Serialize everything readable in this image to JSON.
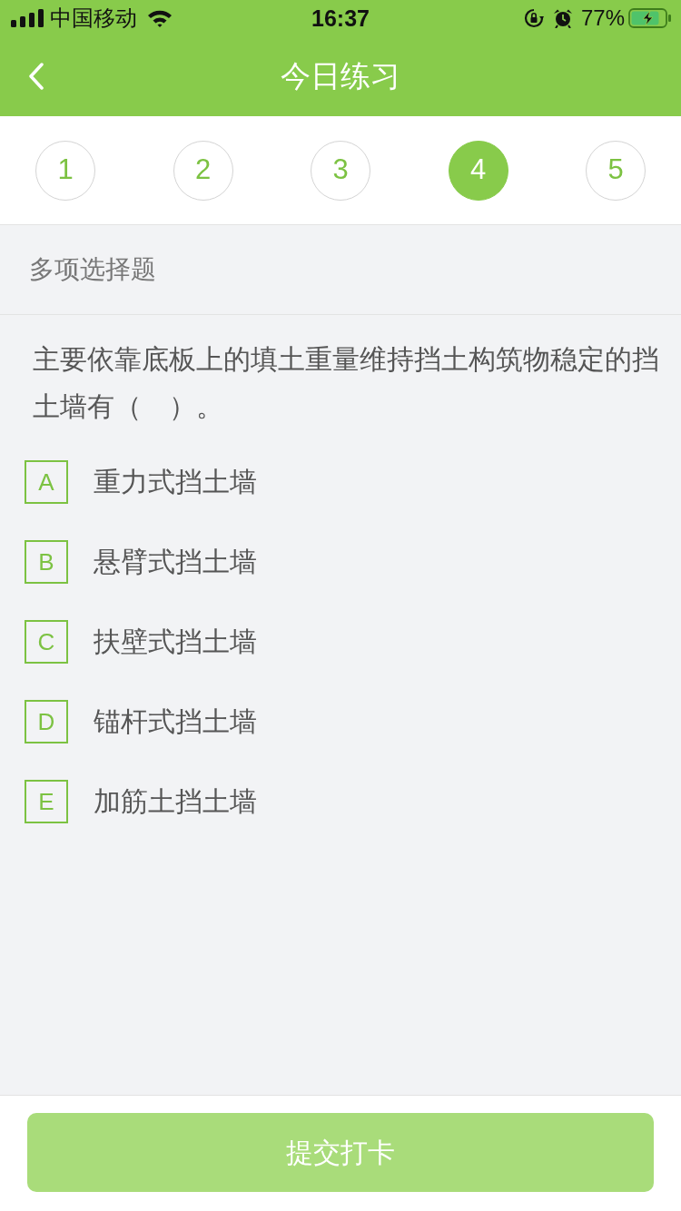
{
  "status_bar": {
    "carrier": "中国移动",
    "time": "16:37",
    "battery": "77%"
  },
  "nav_bar": {
    "title": "今日练习"
  },
  "question_tabs": [
    {
      "label": "1",
      "selected": false
    },
    {
      "label": "2",
      "selected": false
    },
    {
      "label": "3",
      "selected": false
    },
    {
      "label": "4",
      "selected": true
    },
    {
      "label": "5",
      "selected": false
    }
  ],
  "section": {
    "title": "多项选择题"
  },
  "question": {
    "text": "主要依靠底板上的填土重量维持挡土构筑物稳定的挡土墙有（　）。",
    "options": [
      {
        "letter": "A",
        "text": "重力式挡土墙",
        "selected": false
      },
      {
        "letter": "B",
        "text": "悬臂式挡土墙",
        "selected": false
      },
      {
        "letter": "C",
        "text": "扶壁式挡土墙",
        "selected": false
      },
      {
        "letter": "D",
        "text": "锚杆式挡土墙",
        "selected": false
      },
      {
        "letter": "E",
        "text": "加筋土挡土墙",
        "selected": false
      }
    ]
  },
  "submit_button": {
    "label": "提交打卡",
    "disabled": true
  }
}
